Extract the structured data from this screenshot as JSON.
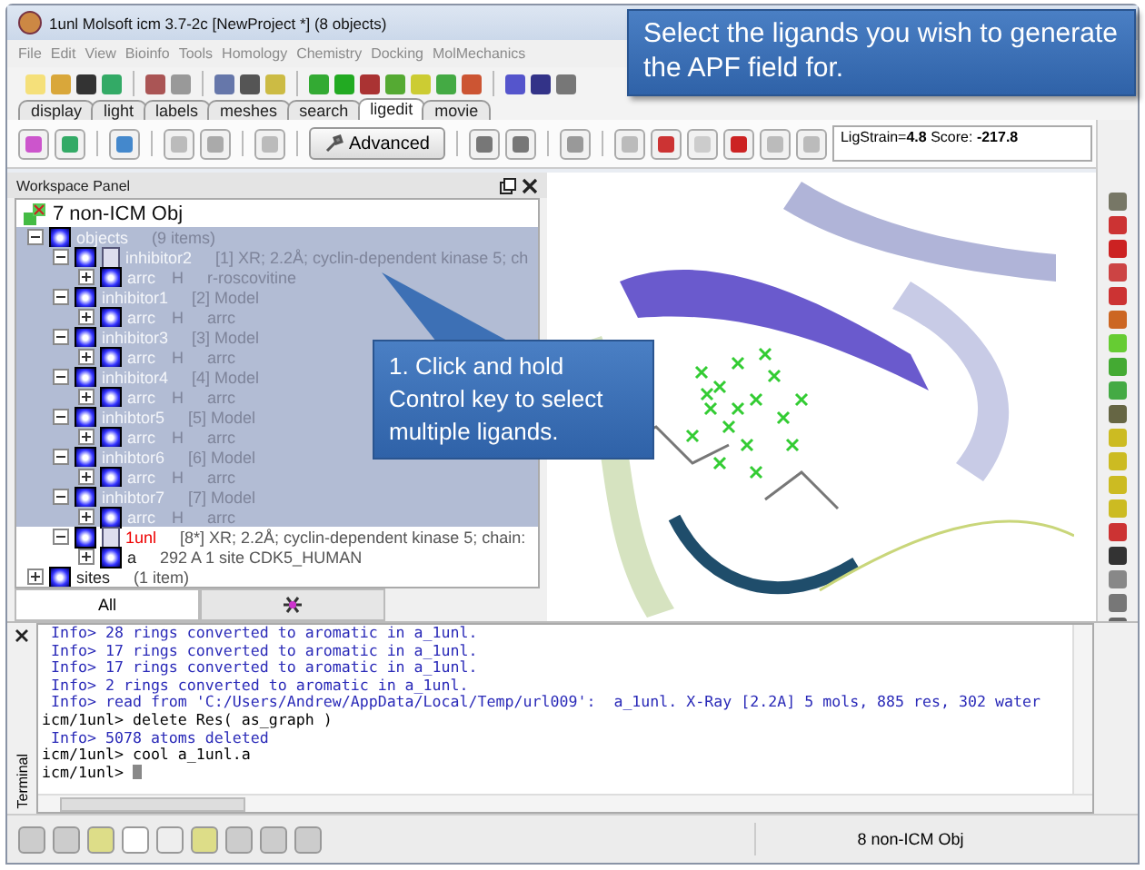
{
  "window": {
    "title": "1unl Molsoft icm 3.7-2c  [NewProject *] (8 objects)"
  },
  "menu": [
    "File",
    "Edit",
    "View",
    "Bioinfo",
    "Tools",
    "Homology",
    "Chemistry",
    "Docking",
    "MolMechanics"
  ],
  "tabs": [
    {
      "label": "display",
      "selected": false
    },
    {
      "label": "light",
      "selected": false
    },
    {
      "label": "labels",
      "selected": false
    },
    {
      "label": "meshes",
      "selected": false
    },
    {
      "label": "search",
      "selected": false
    },
    {
      "label": "ligedit",
      "selected": true
    },
    {
      "label": "movie",
      "selected": false
    }
  ],
  "ligedit": {
    "advanced_button": "Advanced",
    "score": "LigStrain=**4.8** Score: **-217.8**"
  },
  "workspace": {
    "title": "Workspace Panel",
    "root": "7 non-ICM Obj",
    "tree": [
      {
        "name": "objects",
        "info": "(9 items)",
        "selected": true,
        "expanded": true,
        "children": [
          {
            "name": "inhibitor2",
            "kind": "xray",
            "info": "[1] XR; 2.2Å; cyclin-dependent kinase 5; ch",
            "active": false,
            "selected": true,
            "expanded": true,
            "children": [
              {
                "name": "arrc",
                "flag": "H",
                "info": "r-roscovitine",
                "selected": true,
                "expanded": false
              }
            ]
          },
          {
            "name": "inhibitor1",
            "kind": "model",
            "info": "[2] Model",
            "active": false,
            "selected": true,
            "expanded": true,
            "children": [
              {
                "name": "arrc",
                "flag": "H",
                "info": "arrc",
                "selected": true,
                "expanded": false
              }
            ]
          },
          {
            "name": "inhibitor3",
            "kind": "model",
            "info": "[3] Model",
            "active": false,
            "selected": true,
            "expanded": true,
            "children": [
              {
                "name": "arrc",
                "flag": "H",
                "info": "arrc",
                "selected": true,
                "expanded": false
              }
            ]
          },
          {
            "name": "inhibitor4",
            "kind": "model",
            "info": "[4] Model",
            "active": false,
            "selected": true,
            "expanded": true,
            "children": [
              {
                "name": "arrc",
                "flag": "H",
                "info": "arrc",
                "selected": true,
                "expanded": false
              }
            ]
          },
          {
            "name": "inhibtor5",
            "kind": "model",
            "info": "[5] Model",
            "active": false,
            "selected": true,
            "expanded": true,
            "children": [
              {
                "name": "arrc",
                "flag": "H",
                "info": "arrc",
                "selected": true,
                "expanded": false
              }
            ]
          },
          {
            "name": "inhibtor6",
            "kind": "model",
            "info": "[6] Model",
            "active": false,
            "selected": true,
            "expanded": true,
            "children": [
              {
                "name": "arrc",
                "flag": "H",
                "info": "arrc",
                "selected": true,
                "expanded": false
              }
            ]
          },
          {
            "name": "inhibtor7",
            "kind": "model",
            "info": "[7] Model",
            "active": false,
            "selected": true,
            "expanded": true,
            "children": [
              {
                "name": "arrc",
                "flag": "H",
                "info": "arrc",
                "selected": true,
                "expanded": false
              }
            ]
          },
          {
            "name": "1unl",
            "kind": "xray",
            "info": "[8*] XR; 2.2Å; cyclin-dependent kinase 5; chain:",
            "active": true,
            "selected": false,
            "expanded": true,
            "children": [
              {
                "name": "a",
                "info": "292 A  1 site CDK5_HUMAN",
                "selected": false,
                "expanded": false
              }
            ]
          }
        ]
      },
      {
        "name": "sites",
        "info": "(1 item)",
        "selected": false,
        "expanded": false
      }
    ],
    "tabs": [
      {
        "kind": "text",
        "label": "All",
        "selected": true
      },
      {
        "kind": "icon",
        "selected": false
      }
    ]
  },
  "terminal": {
    "title": "Terminal",
    "lines": [
      {
        "kind": "info",
        "text": " Info> 28 rings converted to aromatic in a_1unl."
      },
      {
        "kind": "info",
        "text": " Info> 17 rings converted to aromatic in a_1unl."
      },
      {
        "kind": "info",
        "text": " Info> 17 rings converted to aromatic in a_1unl."
      },
      {
        "kind": "info",
        "text": " Info> 2 rings converted to aromatic in a_1unl."
      },
      {
        "kind": "info",
        "text": " Info> read from 'C:/Users/Andrew/AppData/Local/Temp/url009':  a_1unl. X-Ray [2.2A] 5 mols, 885 res, 302 water"
      },
      {
        "kind": "prompt",
        "text": "icm/1unl> delete Res( as_graph )"
      },
      {
        "kind": "info",
        "text": " Info> 5078 atoms deleted"
      },
      {
        "kind": "prompt",
        "text": "icm/1unl> cool a_1unl.a"
      },
      {
        "kind": "prompt",
        "text": "icm/1unl> "
      }
    ]
  },
  "status_bar": {
    "text": "8 non-ICM Obj"
  },
  "callouts": [
    {
      "kind": "banner",
      "text": "Select the ligands you wish to generate the APF field for."
    },
    {
      "kind": "pointer",
      "text": "1. Click and hold Control key to select multiple ligands."
    }
  ]
}
